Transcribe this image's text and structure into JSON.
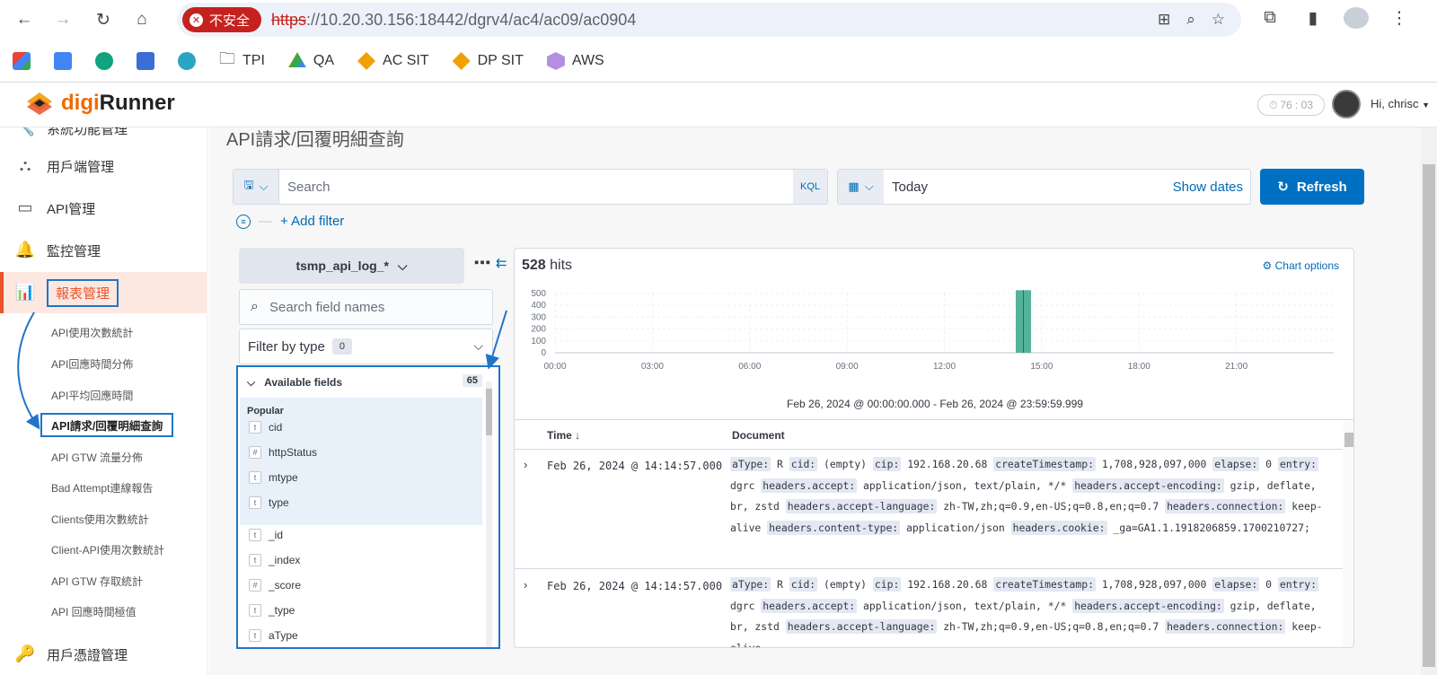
{
  "browser": {
    "insecure_label": "不安全",
    "url_scheme": "https",
    "url_rest": "://10.20.30.156:18442/dgrv4/ac4/ac09/ac0904",
    "bookmarks": [
      "TPI",
      "QA",
      "AC SIT",
      "DP SIT",
      "AWS"
    ]
  },
  "header": {
    "logo_dg": "digi",
    "logo_runner": "Runner",
    "timer": "76 : 03",
    "user": "Hi, chrisc"
  },
  "sidebar": {
    "items": [
      {
        "label": "系統功能管理",
        "icon": "wrench-icon"
      },
      {
        "label": "用戶端管理",
        "icon": "network-icon"
      },
      {
        "label": "API管理",
        "icon": "server-icon"
      },
      {
        "label": "監控管理",
        "icon": "bell-icon"
      },
      {
        "label": "報表管理",
        "icon": "chart-icon"
      },
      {
        "label": "用戶憑證管理",
        "icon": "key-icon"
      }
    ],
    "sub_items": [
      "API使用次數統計",
      "API回應時間分佈",
      "API平均回應時間",
      "API請求/回覆明細查詢",
      "API GTW 流量分佈",
      "Bad Attempt連線報告",
      "Clients使用次數統計",
      "Client-API使用次數統計",
      "API GTW 存取統計",
      "API 回應時間極值"
    ]
  },
  "main": {
    "title": "API請求/回覆明細查詢",
    "search_placeholder": "Search",
    "kql": "KQL",
    "date": "Today",
    "show_dates": "Show dates",
    "refresh": "Refresh",
    "add_filter": "+ Add filter",
    "index_pattern": "tsmp_api_log_*",
    "field_search_placeholder": "Search field names",
    "filter_by_type": "Filter by type",
    "filter_count": "0",
    "available_fields": "Available fields",
    "available_count": "65",
    "popular": "Popular",
    "popular_fields": [
      {
        "type": "t",
        "name": "cid"
      },
      {
        "type": "#",
        "name": "httpStatus"
      },
      {
        "type": "t",
        "name": "mtype"
      },
      {
        "type": "t",
        "name": "type"
      }
    ],
    "other_fields": [
      {
        "type": "t",
        "name": "_id"
      },
      {
        "type": "t",
        "name": "_index"
      },
      {
        "type": "#",
        "name": "_score"
      },
      {
        "type": "t",
        "name": "_type"
      },
      {
        "type": "t",
        "name": "aType"
      }
    ],
    "hits_count": "528",
    "hits_label": "hits",
    "chart_options": "Chart options",
    "date_range": "Feb 26, 2024 @ 00:00:00.000 - Feb 26, 2024 @ 23:59:59.999",
    "col_time": "Time ↓",
    "col_document": "Document",
    "rows": [
      {
        "time": "Feb 26, 2024 @ 14:14:57.000"
      },
      {
        "time": "Feb 26, 2024 @ 14:14:57.000"
      }
    ],
    "doc_pairs": [
      {
        "k": "aType:",
        "v": "R"
      },
      {
        "k": "cid:",
        "v": "(empty)"
      },
      {
        "k": "cip:",
        "v": "192.168.20.68"
      },
      {
        "k": "createTimestamp:",
        "v": "1,708,928,097,000"
      },
      {
        "k": "elapse:",
        "v": "0"
      },
      {
        "k": "entry:",
        "v": "dgrc"
      },
      {
        "k": "headers.accept:",
        "v": "application/json, text/plain, */*"
      },
      {
        "k": "headers.accept-encoding:",
        "v": "gzip, deflate, br, zstd"
      },
      {
        "k": "headers.accept-language:",
        "v": "zh-TW,zh;q=0.9,en-US;q=0.8,en;q=0.7"
      },
      {
        "k": "headers.connection:",
        "v": "keep-alive"
      },
      {
        "k": "headers.content-type:",
        "v": "application/json"
      },
      {
        "k": "headers.cookie:",
        "v": "_ga=GA1.1.1918206859.1700210727;"
      }
    ]
  },
  "chart_data": {
    "type": "bar",
    "x_ticks": [
      "00:00",
      "03:00",
      "06:00",
      "09:00",
      "12:00",
      "15:00",
      "18:00",
      "21:00"
    ],
    "y_ticks": [
      0,
      100,
      200,
      300,
      400,
      500
    ],
    "ylim": [
      0,
      500
    ],
    "bars": [
      {
        "hour": 14.2,
        "value": 528
      }
    ],
    "bar_color": "#54b399"
  }
}
